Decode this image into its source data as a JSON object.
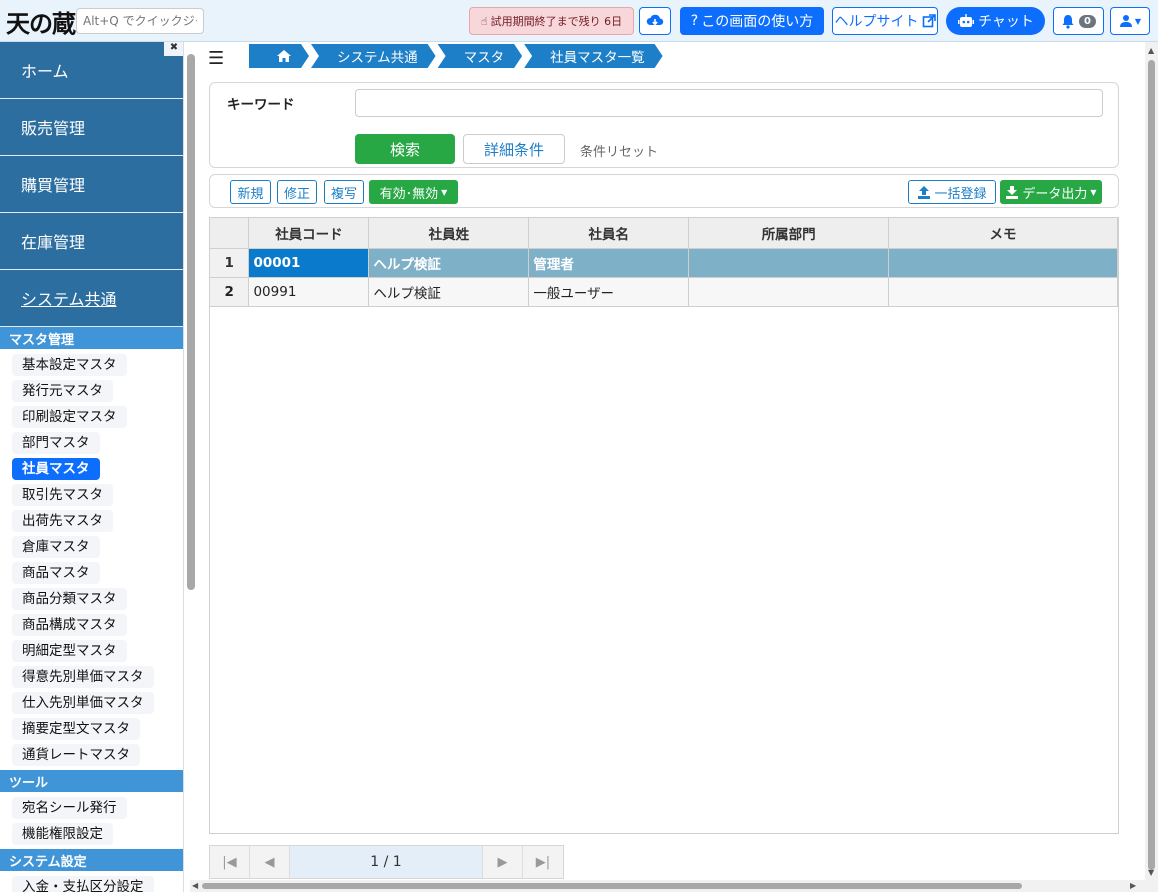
{
  "header": {
    "logo": "天の蔵",
    "quickjump_placeholder": "Alt+Q でクイックジャンプ",
    "trial_notice": "試用期間終了まで残り 6日",
    "howto_label": "この画面の使い方",
    "helpsite_label": "ヘルプサイト",
    "chat_label": "チャット",
    "notification_count": "0"
  },
  "sidebar": {
    "main_items": [
      {
        "label": "ホーム"
      },
      {
        "label": "販売管理"
      },
      {
        "label": "購買管理"
      },
      {
        "label": "在庫管理"
      },
      {
        "label": "システム共通"
      }
    ],
    "sections": [
      {
        "title": "マスタ管理",
        "items": [
          "基本設定マスタ",
          "発行元マスタ",
          "印刷設定マスタ",
          "部門マスタ",
          "社員マスタ",
          "取引先マスタ",
          "出荷先マスタ",
          "倉庫マスタ",
          "商品マスタ",
          "商品分類マスタ",
          "商品構成マスタ",
          "明細定型マスタ",
          "得意先別単価マスタ",
          "仕入先別単価マスタ",
          "摘要定型文マスタ",
          "通貨レートマスタ"
        ]
      },
      {
        "title": "ツール",
        "items": [
          "宛名シール発行",
          "機能権限設定"
        ]
      },
      {
        "title": "システム設定",
        "items": [
          "入金・支払区分設定"
        ]
      }
    ]
  },
  "breadcrumb": [
    "システム共通",
    "マスタ",
    "社員マスタ一覧"
  ],
  "search": {
    "keyword_label": "キーワード",
    "search_label": "検索",
    "detail_label": "詳細条件",
    "reset_label": "条件リセット"
  },
  "toolbar": {
    "new_label": "新規",
    "edit_label": "修正",
    "copy_label": "複写",
    "toggle_label": "有効･無効",
    "bulk_label": "一括登録",
    "export_label": "データ出力"
  },
  "table": {
    "columns": [
      "社員コード",
      "社員姓",
      "社員名",
      "所属部門",
      "メモ"
    ],
    "rows": [
      {
        "no": "1",
        "code": "00001",
        "last": "ヘルプ検証",
        "first": "管理者",
        "dept": "",
        "memo": ""
      },
      {
        "no": "2",
        "code": "00991",
        "last": "ヘルプ検証",
        "first": "一般ユーザー",
        "dept": "",
        "memo": ""
      }
    ]
  },
  "pager": {
    "info": "1 / 1"
  },
  "colors": {
    "accent": "#0d6efd",
    "nav": "#2c6ea0",
    "section": "#3f95d8",
    "success": "#28a745",
    "selected_row": "#7eb0c8"
  }
}
